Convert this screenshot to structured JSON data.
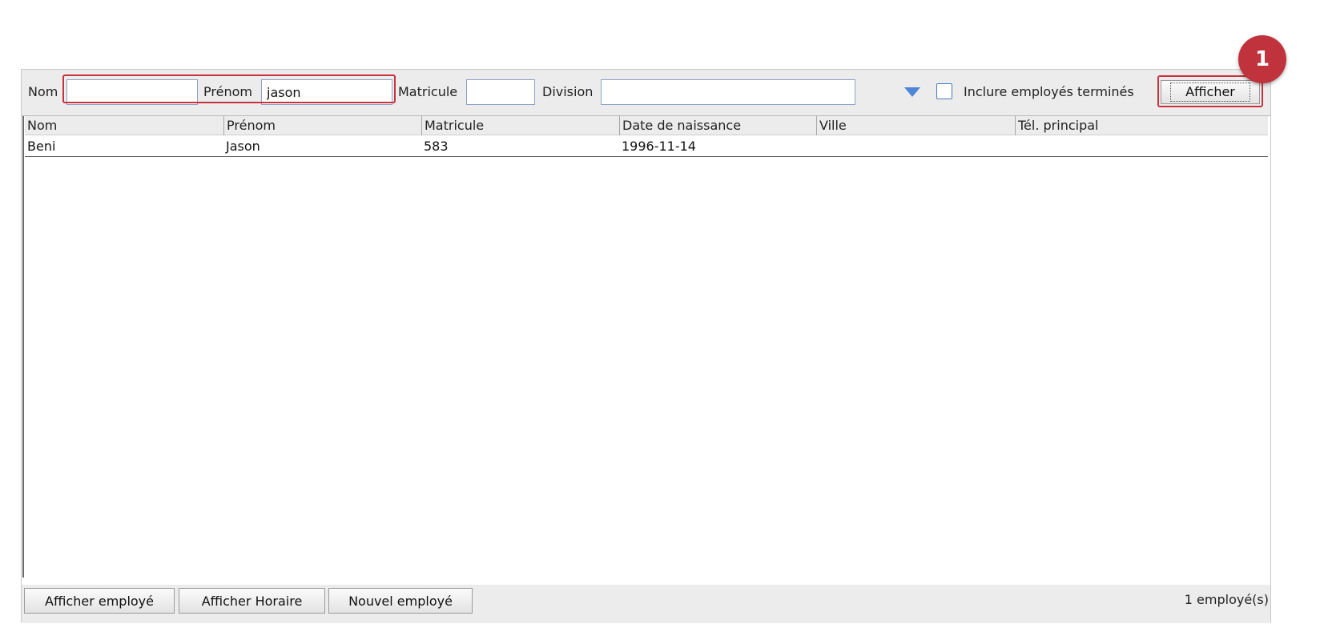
{
  "filters": {
    "nom_label": "Nom",
    "nom_value": "",
    "prenom_label": "Prénom",
    "prenom_value": "jason",
    "matricule_label": "Matricule",
    "matricule_value": "",
    "division_label": "Division",
    "division_value": "",
    "include_terminated_label": "Inclure employés terminés",
    "include_terminated_checked": false,
    "show_button_label": "Afficher"
  },
  "table": {
    "columns": [
      "Nom",
      "Prénom",
      "Matricule",
      "Date de naissance",
      "Ville",
      "Tél. principal"
    ],
    "rows": [
      [
        "Beni",
        "Jason",
        "583",
        "1996-11-14",
        "",
        ""
      ]
    ]
  },
  "footer": {
    "show_employee_label": "Afficher employé",
    "show_schedule_label": "Afficher Horaire",
    "new_employee_label": "Nouvel employé",
    "count_label": "1 employé(s)"
  },
  "annotation": {
    "badge_label": "1",
    "highlight_color": "#c9323c",
    "badge_color": "#c0333c"
  },
  "colors": {
    "accent": "#4f87d6",
    "toolbar_bg": "#ececec"
  }
}
